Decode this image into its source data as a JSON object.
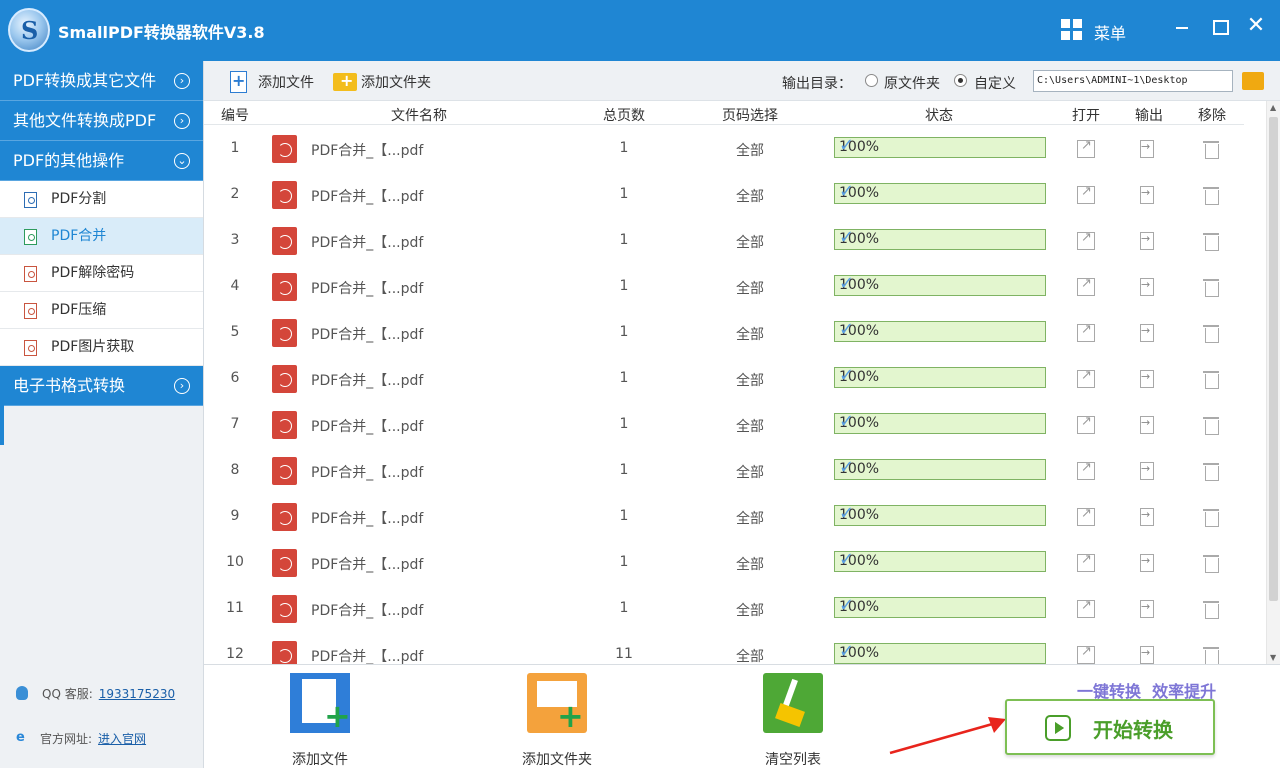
{
  "app": {
    "title": "SmallPDF转换器软件V3.8",
    "menu_label": "菜单"
  },
  "sidebar": {
    "categories": [
      {
        "label": "PDF转换成其它文件",
        "expanded": false
      },
      {
        "label": "其他文件转换成PDF",
        "expanded": false
      },
      {
        "label": "PDF的其他操作",
        "expanded": true
      },
      {
        "label": "电子书格式转换",
        "expanded": false
      }
    ],
    "subitems": [
      {
        "label": "PDF分割",
        "active": false
      },
      {
        "label": "PDF合并",
        "active": true
      },
      {
        "label": "PDF解除密码",
        "active": false
      },
      {
        "label": "PDF压缩",
        "active": false
      },
      {
        "label": "PDF图片获取",
        "active": false
      }
    ],
    "contact": {
      "qq_label": "QQ 客服:",
      "qq_value": "1933175230",
      "site_label": "官方网址:",
      "site_link": "进入官网"
    }
  },
  "toolbar": {
    "add_file": "添加文件",
    "add_folder": "添加文件夹",
    "output_label": "输出目录：",
    "option_original": "原文件夹",
    "option_custom": "自定义",
    "selected_option": "custom",
    "output_path": "C:\\Users\\ADMINI~1\\Desktop"
  },
  "table": {
    "headers": {
      "num": "编号",
      "name": "文件名称",
      "pages": "总页数",
      "range": "页码选择",
      "status": "状态",
      "open": "打开",
      "export": "输出",
      "remove": "移除"
    },
    "rows": [
      {
        "num": "1",
        "name": "PDF合并_【...pdf",
        "pages": "1",
        "range": "全部",
        "status": "100%"
      },
      {
        "num": "2",
        "name": "PDF合并_【...pdf",
        "pages": "1",
        "range": "全部",
        "status": "100%"
      },
      {
        "num": "3",
        "name": "PDF合并_【...pdf",
        "pages": "1",
        "range": "全部",
        "status": "100%"
      },
      {
        "num": "4",
        "name": "PDF合并_【...pdf",
        "pages": "1",
        "range": "全部",
        "status": "100%"
      },
      {
        "num": "5",
        "name": "PDF合并_【...pdf",
        "pages": "1",
        "range": "全部",
        "status": "100%"
      },
      {
        "num": "6",
        "name": "PDF合并_【...pdf",
        "pages": "1",
        "range": "全部",
        "status": "100%"
      },
      {
        "num": "7",
        "name": "PDF合并_【...pdf",
        "pages": "1",
        "range": "全部",
        "status": "100%"
      },
      {
        "num": "8",
        "name": "PDF合并_【...pdf",
        "pages": "1",
        "range": "全部",
        "status": "100%"
      },
      {
        "num": "9",
        "name": "PDF合并_【...pdf",
        "pages": "1",
        "range": "全部",
        "status": "100%"
      },
      {
        "num": "10",
        "name": "PDF合并_【...pdf",
        "pages": "1",
        "range": "全部",
        "status": "100%"
      },
      {
        "num": "11",
        "name": "PDF合并_【...pdf",
        "pages": "1",
        "range": "全部",
        "status": "100%"
      },
      {
        "num": "12",
        "name": "PDF合并_【...pdf",
        "pages": "11",
        "range": "全部",
        "status": "100%"
      }
    ]
  },
  "bottom": {
    "add_file": "添加文件",
    "add_folder": "添加文件夹",
    "clear_list": "清空列表",
    "slogan": "一键转换  效率提升",
    "start": "开始转换"
  }
}
